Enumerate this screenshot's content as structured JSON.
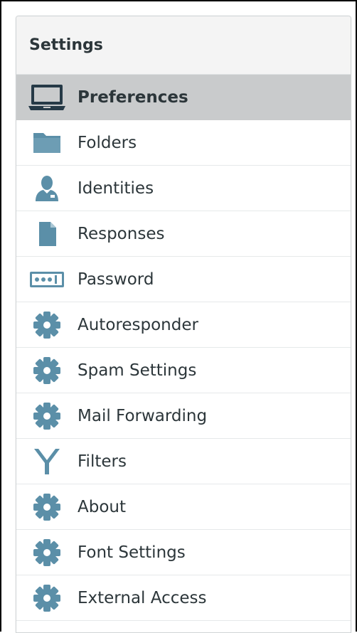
{
  "settings": {
    "title": "Settings",
    "accent_icon_color": "#5b8fa8",
    "selected_icon_color": "#263a47",
    "selected_bg": "#c9cbcc",
    "items": [
      {
        "label": "Preferences",
        "icon": "laptop-icon",
        "selected": true
      },
      {
        "label": "Folders",
        "icon": "folder-icon"
      },
      {
        "label": "Identities",
        "icon": "user-icon"
      },
      {
        "label": "Responses",
        "icon": "document-icon"
      },
      {
        "label": "Password",
        "icon": "password-icon"
      },
      {
        "label": "Autoresponder",
        "icon": "gear-icon"
      },
      {
        "label": "Spam Settings",
        "icon": "gear-icon"
      },
      {
        "label": "Mail Forwarding",
        "icon": "gear-icon"
      },
      {
        "label": "Filters",
        "icon": "filter-icon"
      },
      {
        "label": "About",
        "icon": "gear-icon"
      },
      {
        "label": "Font Settings",
        "icon": "gear-icon"
      },
      {
        "label": "External Access",
        "icon": "gear-icon"
      }
    ]
  }
}
